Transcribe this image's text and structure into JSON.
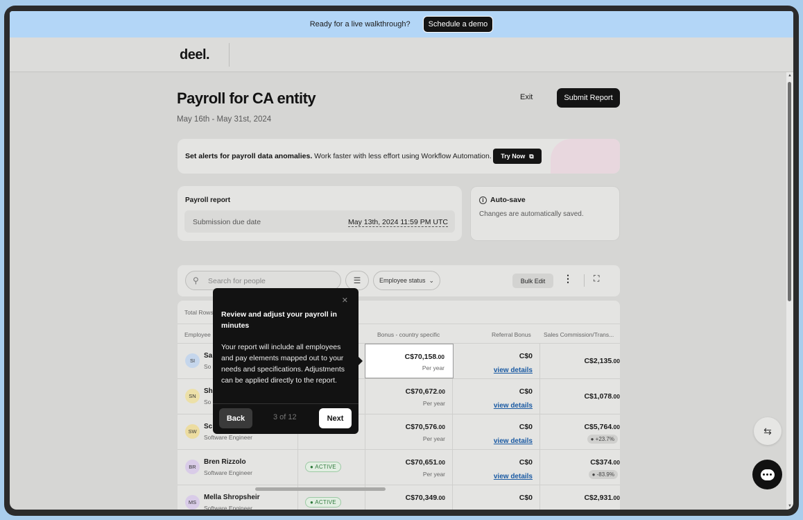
{
  "banner": {
    "text": "Ready for a live walkthrough?",
    "cta": "Schedule a demo"
  },
  "header": {
    "logo": "deel."
  },
  "page": {
    "title": "Payroll for CA entity",
    "dates": "May 16th - May 31st, 2024",
    "exit": "Exit",
    "submit": "Submit Report"
  },
  "alert": {
    "bold": "Set alerts for payroll data anomalies.",
    "text": " Work faster with less effort using Workflow Automation.",
    "cta": "Try Now"
  },
  "report": {
    "label": "Payroll report",
    "due_label": "Submission due date",
    "due_value": "May 13th, 2024 11:59 PM UTC"
  },
  "autosave": {
    "title": "Auto-save",
    "desc": "Changes are automatically saved."
  },
  "toolbar": {
    "search_placeholder": "Search for people",
    "status_filter": "Employee status",
    "bulk_edit": "Bulk Edit"
  },
  "table": {
    "total_rows": "Total Rows",
    "headers": {
      "employee": "Employee",
      "bonus": "Bonus - country specific",
      "referral": "Referral Bonus",
      "sales": "Sales Commission/Trans..."
    },
    "view_details": "view details",
    "per_year": "Per year",
    "rows": [
      {
        "initials": "SI",
        "name": "Sa",
        "role": "So",
        "status": "",
        "bonus_main": "C$70,158",
        "bonus_dec": ".00",
        "referral": "C$0",
        "sales_main": "C$2,135",
        "sales_dec": ".00",
        "pct": ""
      },
      {
        "initials": "SN",
        "name": "Sh",
        "role": "So",
        "status": "",
        "bonus_main": "C$70,672",
        "bonus_dec": ".00",
        "referral": "C$0",
        "sales_main": "C$1,078",
        "sales_dec": ".00",
        "pct": ""
      },
      {
        "initials": "SW",
        "name": "Sc",
        "role": "Software Engineer",
        "status": "",
        "bonus_main": "C$70,576",
        "bonus_dec": ".00",
        "referral": "C$0",
        "sales_main": "C$5,764",
        "sales_dec": ".00",
        "pct": "+23.7%"
      },
      {
        "initials": "BR",
        "name": "Bren Rizzolo",
        "role": "Software Engineer",
        "status": "ACTIVE",
        "bonus_main": "C$70,651",
        "bonus_dec": ".00",
        "referral": "C$0",
        "sales_main": "C$374",
        "sales_dec": ".00",
        "pct": "-83.9%"
      },
      {
        "initials": "MS",
        "name": "Mella Shropsheir",
        "role": "Software Engineer",
        "status": "ACTIVE",
        "bonus_main": "C$70,349",
        "bonus_dec": ".00",
        "referral": "C$0",
        "sales_main": "C$2,931",
        "sales_dec": ".00",
        "pct": ""
      }
    ]
  },
  "tour": {
    "heading": "Review and adjust your payroll in minutes",
    "body": "Your report will include all employees and pay elements mapped out to your needs and specifications. Adjustments can be applied directly to the report.",
    "back": "Back",
    "step": "3 of 12",
    "next": "Next"
  },
  "colors": {
    "banner": "#b3d6f7",
    "accent": "#141414",
    "link": "#1a5aa3",
    "active": "#2f7a3c"
  }
}
